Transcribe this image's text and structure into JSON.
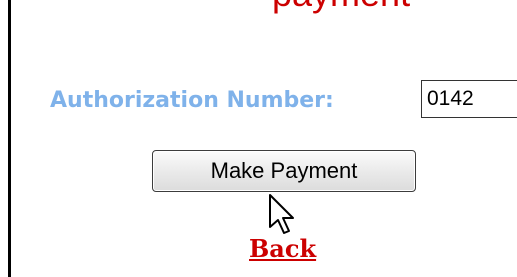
{
  "page": {
    "heading_partial": "payment"
  },
  "form": {
    "auth_label": "Authorization Number:",
    "auth_value": "0142",
    "pay_button_label": "Make Payment",
    "back_link_label": "Back"
  },
  "colors": {
    "label": "#7fb2ea",
    "link": "#cc0000",
    "heading": "#cc0000"
  },
  "icons": {
    "cursor": "mouse-pointer-icon"
  }
}
